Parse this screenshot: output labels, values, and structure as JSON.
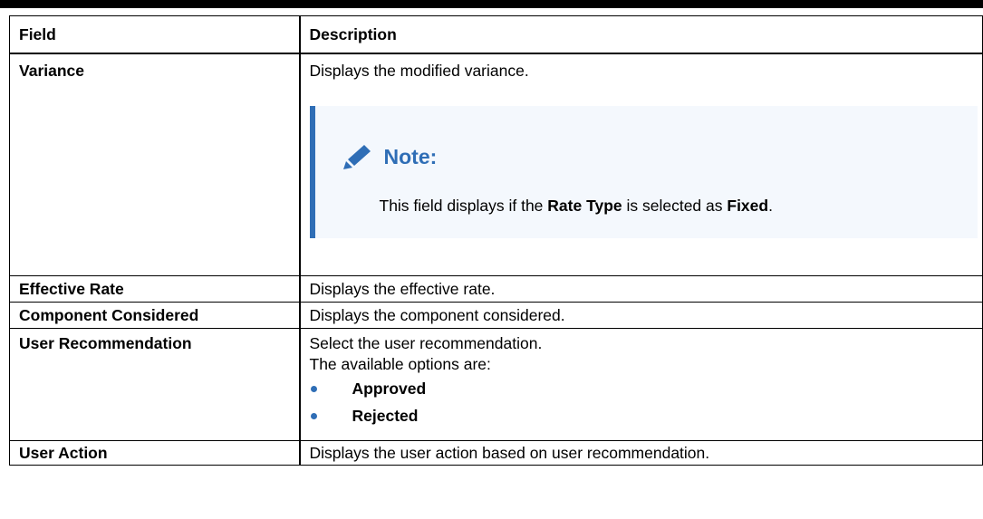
{
  "table": {
    "headers": {
      "field": "Field",
      "description": "Description"
    },
    "rows": [
      {
        "field": "Variance",
        "description": "Displays the modified variance.",
        "note": {
          "title": "Note:",
          "text_pre": "This field displays if the ",
          "text_bold1": "Rate Type",
          "text_mid": " is selected as ",
          "text_bold2": "Fixed",
          "text_post": "."
        }
      },
      {
        "field": "Effective Rate",
        "description": "Displays the effective rate."
      },
      {
        "field": "Component Considered",
        "description": "Displays the component considered."
      },
      {
        "field": "User Recommendation",
        "description": "Select the user recommendation.",
        "options_intro": "The available options are:",
        "options": [
          "Approved",
          "Rejected"
        ]
      },
      {
        "field": "User Action",
        "description": "Displays the user action based on user recommendation."
      }
    ]
  },
  "colors": {
    "note_accent": "#2f6eb6",
    "note_background": "#f4f8fd"
  },
  "icons": {
    "note_icon": "pencil-icon"
  }
}
